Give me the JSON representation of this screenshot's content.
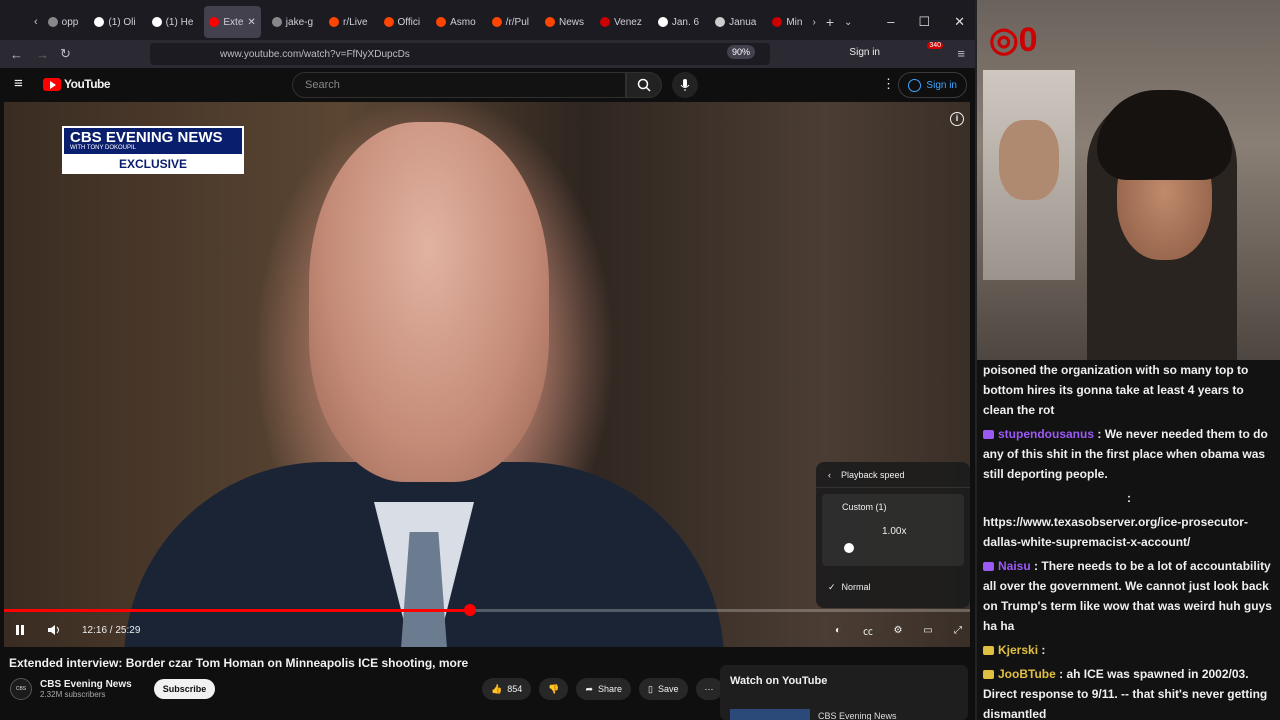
{
  "browser": {
    "tabs": [
      {
        "label": "opp",
        "color": "#888888"
      },
      {
        "label": "(1) Oli",
        "color": "#ffffff"
      },
      {
        "label": "(1) He",
        "color": "#ffffff"
      },
      {
        "label": "Exte",
        "color": "#ff0000"
      },
      {
        "label": "jake-g",
        "color": "#888888"
      },
      {
        "label": "r/Live",
        "color": "#ff4500"
      },
      {
        "label": "Offici",
        "color": "#ff4500"
      },
      {
        "label": "Asmo",
        "color": "#ff4500"
      },
      {
        "label": "/r/Pul",
        "color": "#ff4500"
      },
      {
        "label": "News",
        "color": "#ff4500"
      },
      {
        "label": "Venez",
        "color": "#cc0000"
      },
      {
        "label": "Jan. 6",
        "color": "#ffffff"
      },
      {
        "label": "Janua",
        "color": "#cccccc"
      },
      {
        "label": "Min",
        "color": "#cc0000"
      }
    ],
    "url": "www.youtube.com/watch?v=FfNyXDupcDs",
    "zoom": "90%",
    "signin": "Sign in",
    "badge_count": "340"
  },
  "youtube": {
    "logo": "YouTube",
    "search_placeholder": "Search",
    "signin": "Sign in"
  },
  "video": {
    "overlay_logo_top": "CBS EVENING NEWS",
    "overlay_logo_sub": "WITH TONY DOKOUPIL",
    "overlay_logo_bottom": "EXCLUSIVE",
    "time": "12:16 / 25:29",
    "progress": 0.482,
    "speed_menu": {
      "title": "Playback speed",
      "custom_label": "Custom (1)",
      "custom_value": "1.00x",
      "normal": "Normal"
    }
  },
  "meta": {
    "title": "Extended interview: Border czar Tom Homan on Minneapolis ICE shooting, more",
    "channel": "CBS Evening News",
    "subscribers": "2.32M subscribers",
    "subscribe": "Subscribe",
    "likes": "854",
    "share": "Share",
    "save": "Save",
    "watch_on_yt": "Watch on YouTube",
    "related_channel": "CBS Evening News"
  },
  "chat": [
    {
      "user": "",
      "color": "#efeff1",
      "text": "poisoned the organization with so many top to bottom hires its gonna take at least 4 years to clean the rot"
    },
    {
      "user": "stupendousanus",
      "color": "#9b59f5",
      "text": ": We never needed them to do any of this shit in the first place when obama was still deporting people."
    },
    {
      "user": "",
      "color": "#efeff1",
      "text": ":"
    },
    {
      "user": "",
      "color": "#efeff1",
      "text": "https://www.texasobserver.org/ice-prosecutor-dallas-white-supremacist-x-account/"
    },
    {
      "user": "Naisu",
      "color": "#9b59f5",
      "text": ": There needs to be a lot of accountability all over the government. We cannot just look back on Trump's term like wow that was weird huh guys ha ha"
    },
    {
      "user": "Kjerski",
      "color": "#e0c040",
      "text": ":"
    },
    {
      "user": "JooBTube",
      "color": "#e0c040",
      "text": ": ah ICE was spawned in 2002/03. Direct response to 9/11. -- that shit's never getting dismantled"
    }
  ]
}
